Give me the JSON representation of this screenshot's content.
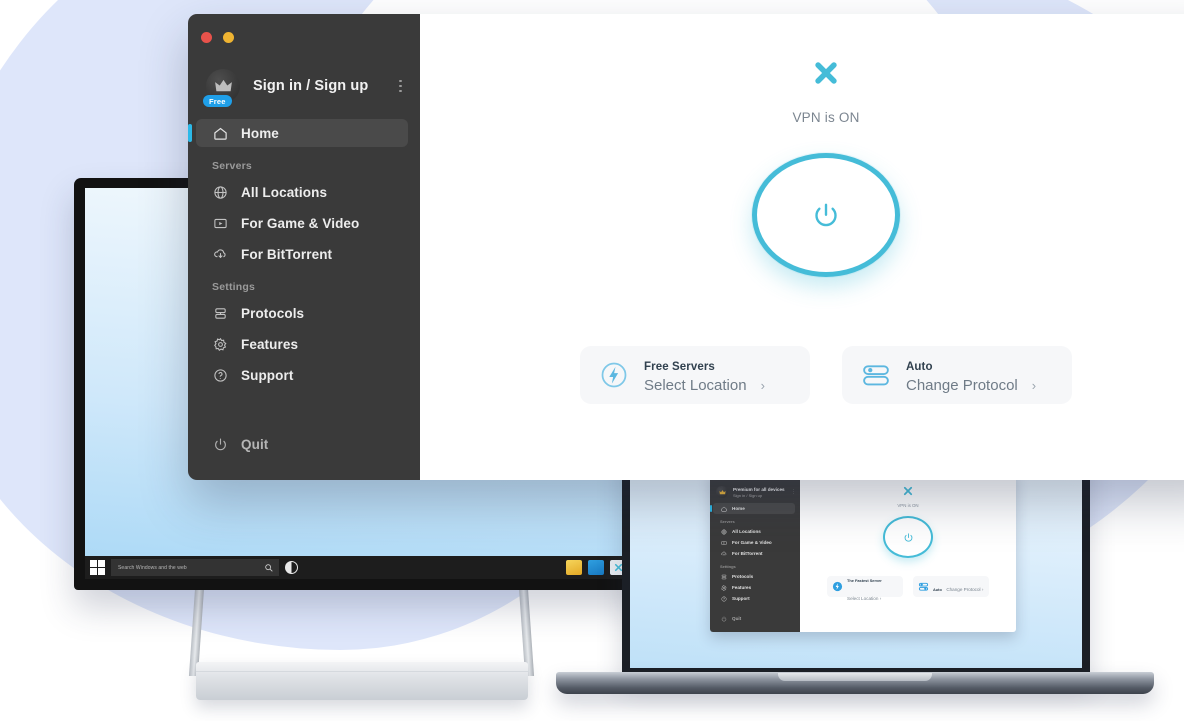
{
  "app": {
    "window_controls": [
      {
        "name": "close",
        "color": "#e8524b"
      },
      {
        "name": "minimize",
        "color": "#efb432"
      }
    ],
    "account": {
      "label": "Sign in / Sign up",
      "badge": "Free",
      "icon": "crown-icon",
      "menu_icon": "kebab-menu-icon"
    },
    "sidebar": {
      "home": {
        "label": "Home",
        "icon": "home-icon",
        "active": true
      },
      "section_servers": "Servers",
      "servers": [
        {
          "label": "All Locations",
          "icon": "globe-icon"
        },
        {
          "label": "For Game & Video",
          "icon": "video-play-icon"
        },
        {
          "label": "For BitTorrent",
          "icon": "cloud-download-icon"
        }
      ],
      "section_settings": "Settings",
      "settings": [
        {
          "label": "Protocols",
          "icon": "server-stack-icon"
        },
        {
          "label": "Features",
          "icon": "gear-icon"
        },
        {
          "label": "Support",
          "icon": "question-circle-icon"
        }
      ],
      "quit": {
        "label": "Quit",
        "icon": "power-icon"
      }
    },
    "main": {
      "logo": "x-vpn-logo",
      "status": "VPN is ON",
      "power_button": {
        "icon": "power-icon",
        "state": "on"
      },
      "cards": [
        {
          "title": "Free Servers",
          "subtitle": "Select Location",
          "icon": "lightning-bolt-circle-icon",
          "chevron": "›"
        },
        {
          "title": "Auto",
          "subtitle": "Change Protocol",
          "icon": "toggle-switches-icon",
          "chevron": "›"
        }
      ]
    }
  },
  "monitor": {
    "taskbar": {
      "start_icon": "windows-start-icon",
      "search_placeholder": "Search Windows and the web",
      "search_icon": "search-icon",
      "cortana_icon": "cortana-circle-icon",
      "apps": [
        {
          "name": "file-explorer-icon"
        },
        {
          "name": "microsoft-store-icon"
        },
        {
          "name": "x-vpn-taskbar-icon"
        }
      ]
    }
  },
  "laptop": {
    "mini_app": {
      "account": {
        "title": "Premium for all devices",
        "subtitle": "Sign in / Sign up",
        "badge_icon": "crown-icon"
      },
      "home": "Home",
      "section_servers": "Servers",
      "servers": [
        "All Locations",
        "For Game & Video",
        "For BitTorrent"
      ],
      "section_settings": "Settings",
      "settings": [
        "Protocols",
        "Features",
        "Support"
      ],
      "quit": "Quit",
      "status": "VPN is ON",
      "cards": [
        {
          "title": "The Fastest Server",
          "subtitle": "Select Location",
          "chevron": "›"
        },
        {
          "title": "Auto",
          "subtitle": "Change Protocol",
          "chevron": "›"
        }
      ]
    }
  },
  "theme": {
    "accent_teal": "#45bcd8",
    "accent_blue": "#2cb9e8",
    "sidebar_bg": "#3a3a3a",
    "blob_bg": "#dee6fa",
    "badge_blue": "#1f9fe8"
  }
}
